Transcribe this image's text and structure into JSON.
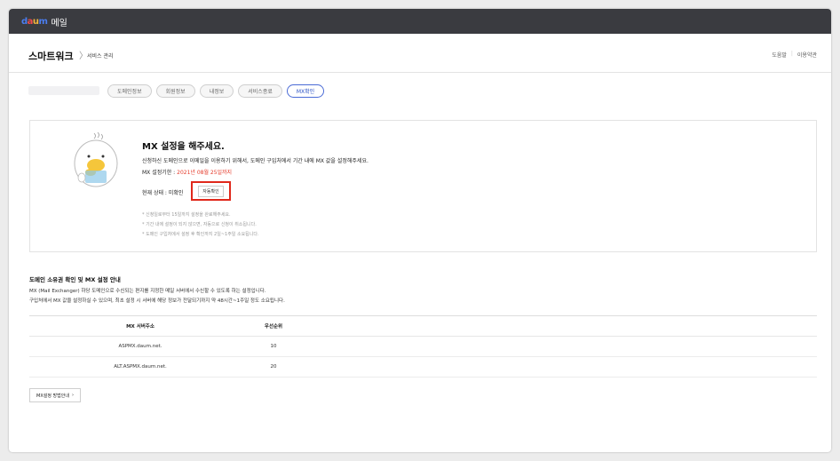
{
  "topbar": {
    "logo_letters": [
      "d",
      "a",
      "u",
      "m"
    ],
    "logo_colors": [
      "#4b7ef0",
      "#f04b4b",
      "#f2b53c",
      "#4b7ef0"
    ],
    "app_label": "메일"
  },
  "header": {
    "title": "스마트워크",
    "chevron": "〉",
    "subtitle": "서비스 관리",
    "links": [
      "도움말",
      "이용약관"
    ],
    "separator": "|"
  },
  "tabs": [
    "도메인정보",
    "회원정보",
    "내정보",
    "서비스종료",
    "MX확인"
  ],
  "active_tab_index": 4,
  "card": {
    "title": "MX 설정을 해주세요.",
    "description": "신청하신 도메인으로 이메일을 이용하기 위해서, 도메인 구입처에서 기간 내에 MX 값을 설정해주세요.",
    "deadline_label": "MX 설정기한 : ",
    "deadline_date": "2021년 08월 25일까지",
    "status_label": "현재 상태 : 미확인",
    "auto_check_button": "자동확인",
    "notes": [
      "* 신청일로부터 15일까지 설정을 완료해주세요.",
      "* 기간 내에 설정이 되지 않으면, 자동으로 신청이 취소됩니다.",
      "* 도메인 구입처에서 설정 후 확인까지 2일~1주일 소요됩니다."
    ]
  },
  "guide": {
    "title": "도메인 소유권 확인 및 MX 설정 안내",
    "lines": [
      "MX (Mail Exchanger) 하당 도메인으로 수신되는 편지를 지정한 메일 서버에서 수신할 수 있도록 하는 설정입니다.",
      "구입처에서 MX 값을 설정하실 수 있으며, 최초 설정 시 서버에 해당 정보가 전달되기까지 약 48시간~1주일 정도 소요됩니다."
    ]
  },
  "mx_table": {
    "headers": [
      "MX 서버주소",
      "우선순위"
    ],
    "rows": [
      [
        "ASPMX.daum.net.",
        "10"
      ],
      [
        "ALT.ASPMX.daum.net.",
        "20"
      ]
    ]
  },
  "mx_guide_button": {
    "label": "MX설정 방법안내",
    "arrow": "›"
  }
}
